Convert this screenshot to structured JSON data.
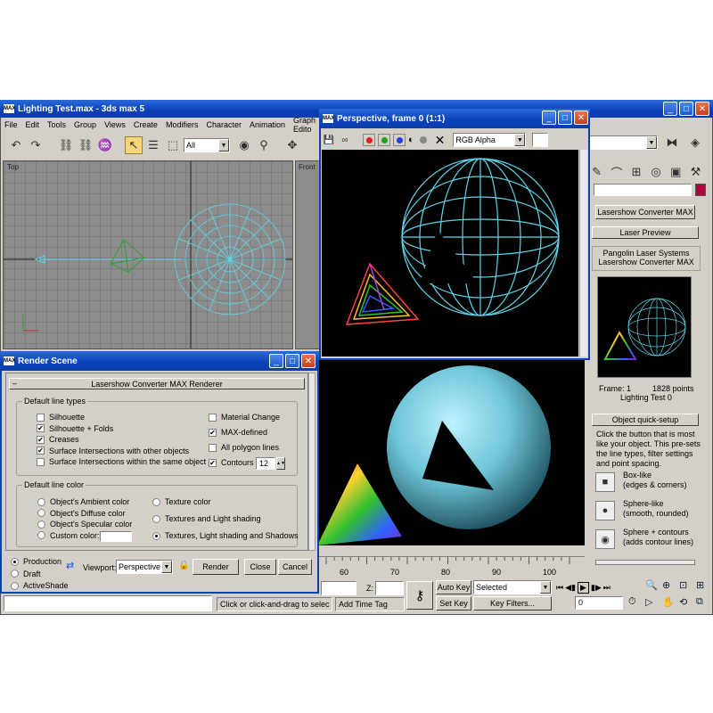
{
  "main": {
    "title": "Lighting Test.max - 3ds max 5",
    "menu": [
      "File",
      "Edit",
      "Tools",
      "Group",
      "Views",
      "Create",
      "Modifiers",
      "Character",
      "Animation",
      "Graph Edito"
    ],
    "selection_filter": "All",
    "viewport_top_label": "Top",
    "viewport_front_label": "Front",
    "right_panel": {
      "rollout_title": "Lasershow Converter MAX",
      "laser_preview_title": "Laser Preview",
      "preview_brand_line1": "Pangolin Laser Systems",
      "preview_brand_line2": "Lasershow Converter MAX",
      "frame_label": "Frame: 1",
      "points_label": "1828 points",
      "scene_name": "Lighting Test 0",
      "quick_setup_title": "Object quick-setup",
      "quick_setup_desc": "Click the button that is most like your object. This pre-sets the line types, filter settings and point spacing.",
      "presets": [
        {
          "line1": "Box-like",
          "line2": "(edges & corners)"
        },
        {
          "line1": "Sphere-like",
          "line2": "(smooth, rounded)"
        },
        {
          "line1": "Sphere + contours",
          "line2": "(adds contour lines)"
        }
      ]
    },
    "timeline_ticks": [
      "60",
      "70",
      "80",
      "90",
      "100"
    ],
    "z_label": "Z:",
    "auto_key": "Auto Key",
    "set_key": "Set Key",
    "key_mode": "Selected",
    "key_filters": "Key Filters...",
    "frame_value": "0",
    "status_prompt": "Click or click-and-drag to selec",
    "add_time_tag": "Add Time Tag"
  },
  "frame_window": {
    "title": "Perspective, frame 0 (1:1)",
    "channel": "RGB Alpha"
  },
  "render_scene": {
    "title": "Render Scene",
    "renderer_title": "Lasershow Converter MAX Renderer",
    "default_line_types_title": "Default line types",
    "line_types_left": [
      {
        "label": "Silhouette",
        "checked": false
      },
      {
        "label": "Silhouette + Folds",
        "checked": true
      },
      {
        "label": "Creases",
        "checked": true
      },
      {
        "label": "Surface Intersections with other objects",
        "checked": true
      },
      {
        "label": "Surface Intersections within the same object",
        "checked": false
      }
    ],
    "line_types_right": [
      {
        "label": "Material Change",
        "checked": false
      },
      {
        "label": "MAX-defined",
        "checked": true
      },
      {
        "label": "All polygon lines",
        "checked": false
      },
      {
        "label": "Contours",
        "checked": true
      }
    ],
    "contours_value": "12",
    "default_line_color_title": "Default line color",
    "colors_left": [
      "Object's Ambient color",
      "Object's Diffuse color",
      "Object's Specular color",
      "Custom color:"
    ],
    "colors_right": [
      "Texture color",
      "Textures and Light shading",
      "Textures, Light shading and Shadows"
    ],
    "selected_color_option": "Textures, Light shading and Shadows",
    "modes": [
      "Production",
      "Draft",
      "ActiveShade"
    ],
    "selected_mode": "Production",
    "viewport_label": "Viewport:",
    "viewport_value": "Perspective",
    "render_label": "Render",
    "close_label": "Close",
    "cancel_label": "Cancel"
  },
  "colors": {
    "titlebar": "#0a40b8",
    "panel": "#d4d0c8",
    "viewport_bg": "#8c8c8c",
    "wire": "#5fd4e8"
  }
}
